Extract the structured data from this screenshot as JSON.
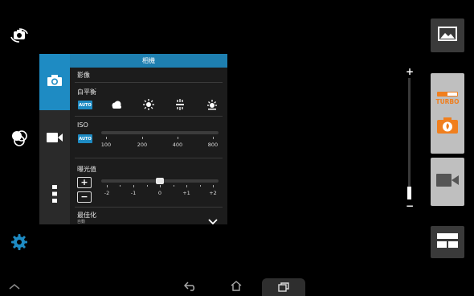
{
  "panel": {
    "title": "相機",
    "section": "影像",
    "white_balance": {
      "label": "白平衡",
      "auto": "AUTO"
    },
    "iso": {
      "label": "ISO",
      "auto": "AUTO",
      "ticks": [
        "100",
        "200",
        "400",
        "800"
      ]
    },
    "exposure": {
      "label": "曝光值",
      "ticks": [
        "-2",
        "-1",
        "0",
        "+1",
        "+2"
      ],
      "plus": "+",
      "minus": "−"
    },
    "optimize": {
      "label": "最佳化",
      "value": "自動"
    }
  },
  "right": {
    "turbo_label": "TURBO",
    "zoom_plus": "+",
    "zoom_minus": "−"
  },
  "colors": {
    "accent": "#1e8bc3",
    "panel_header": "#1e7fb0",
    "turbo_orange": "#f07f1e"
  },
  "icons": [
    "switch-camera-icon",
    "effects-icon",
    "settings-icon",
    "camera-icon",
    "video-icon",
    "more-icon",
    "cloudy-icon",
    "sunny-icon",
    "fluorescent-icon",
    "incandescent-icon",
    "gallery-icon",
    "shutter-icon",
    "video-record-icon",
    "modes-grid-icon",
    "nav-up-icon",
    "back-icon",
    "home-icon",
    "recent-apps-icon",
    "chevron-down-icon"
  ]
}
